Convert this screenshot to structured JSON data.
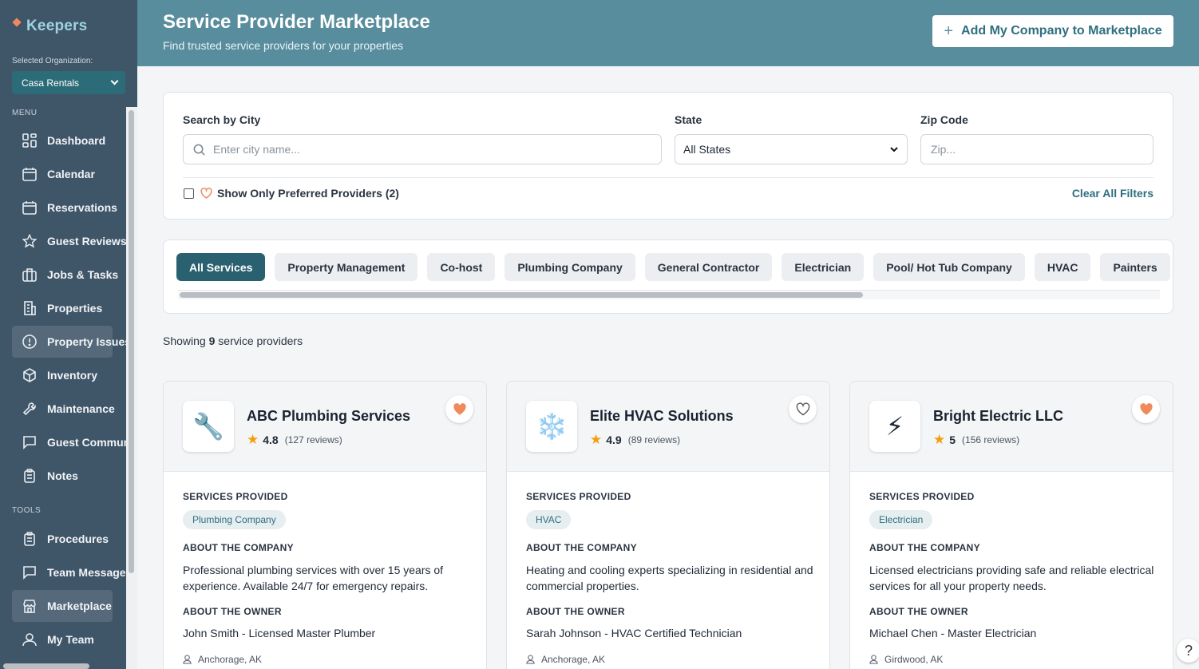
{
  "app": {
    "name": "Keepers"
  },
  "sidebar": {
    "org_label": "Selected Organization:",
    "org_value": "Casa Rentals",
    "menu_label": "MENU",
    "tools_label": "TOOLS",
    "menu_items": [
      {
        "label": "Dashboard",
        "icon": "grid-icon"
      },
      {
        "label": "Calendar",
        "icon": "calendar-icon"
      },
      {
        "label": "Reservations",
        "icon": "calendar-icon"
      },
      {
        "label": "Guest Reviews",
        "icon": "star-icon"
      },
      {
        "label": "Jobs & Tasks",
        "icon": "briefcase-icon"
      },
      {
        "label": "Properties",
        "icon": "building-icon"
      },
      {
        "label": "Property Issues",
        "icon": "alert-circle-icon",
        "active": true
      },
      {
        "label": "Inventory",
        "icon": "box-icon"
      },
      {
        "label": "Maintenance",
        "icon": "wrench-icon"
      },
      {
        "label": "Guest Communication",
        "icon": "chat-icon"
      },
      {
        "label": "Notes",
        "icon": "clipboard-icon"
      }
    ],
    "tool_items": [
      {
        "label": "Procedures",
        "icon": "clipboard-icon"
      },
      {
        "label": "Team Messages",
        "icon": "chat-icon"
      },
      {
        "label": "Marketplace",
        "icon": "store-icon",
        "active": true
      },
      {
        "label": "My Team",
        "icon": "users-icon"
      }
    ]
  },
  "header": {
    "title": "Service Provider Marketplace",
    "subtitle": "Find trusted service providers for your properties",
    "add_button": "Add My Company to Marketplace"
  },
  "filters": {
    "city_label": "Search by City",
    "city_placeholder": "Enter city name...",
    "state_label": "State",
    "state_value": "All States",
    "zip_label": "Zip Code",
    "zip_placeholder": "Zip...",
    "preferred_label": "Show Only Preferred Providers (2)",
    "clear_label": "Clear All Filters"
  },
  "categories": [
    "All Services",
    "Property Management",
    "Co-host",
    "Plumbing Company",
    "General Contractor",
    "Electrician",
    "Pool/ Hot Tub Company",
    "HVAC",
    "Painters"
  ],
  "results": {
    "prefix": "Showing",
    "count": "9",
    "suffix": "service providers"
  },
  "card_labels": {
    "services": "SERVICES PROVIDED",
    "about_company": "ABOUT THE COMPANY",
    "about_owner": "ABOUT THE OWNER"
  },
  "providers": [
    {
      "name": "ABC Plumbing Services",
      "logo": "🔧",
      "rating": "4.8",
      "reviews": "(127 reviews)",
      "favorite": true,
      "service": "Plumbing Company",
      "about": "Professional plumbing services with over 15 years of experience. Available 24/7 for emergency repairs.",
      "owner": "John Smith - Licensed Master Plumber",
      "location": "Anchorage, AK"
    },
    {
      "name": "Elite HVAC Solutions",
      "logo": "❄️",
      "rating": "4.9",
      "reviews": "(89 reviews)",
      "favorite": false,
      "service": "HVAC",
      "about": "Heating and cooling experts specializing in residential and commercial properties.",
      "owner": "Sarah Johnson - HVAC Certified Technician",
      "location": "Anchorage, AK"
    },
    {
      "name": "Bright Electric LLC",
      "logo": "⚡",
      "rating": "5",
      "reviews": "(156 reviews)",
      "favorite": true,
      "service": "Electrician",
      "about": "Licensed electricians providing safe and reliable electrical services for all your property needs.",
      "owner": "Michael Chen - Master Electrician",
      "location": "Girdwood, AK"
    }
  ],
  "help": "?",
  "colors": {
    "accent": "#2a6171",
    "header": "#588d9e",
    "sidebar": "#3f5568",
    "favorite": "#f08a5d",
    "star": "#f59e0b"
  }
}
